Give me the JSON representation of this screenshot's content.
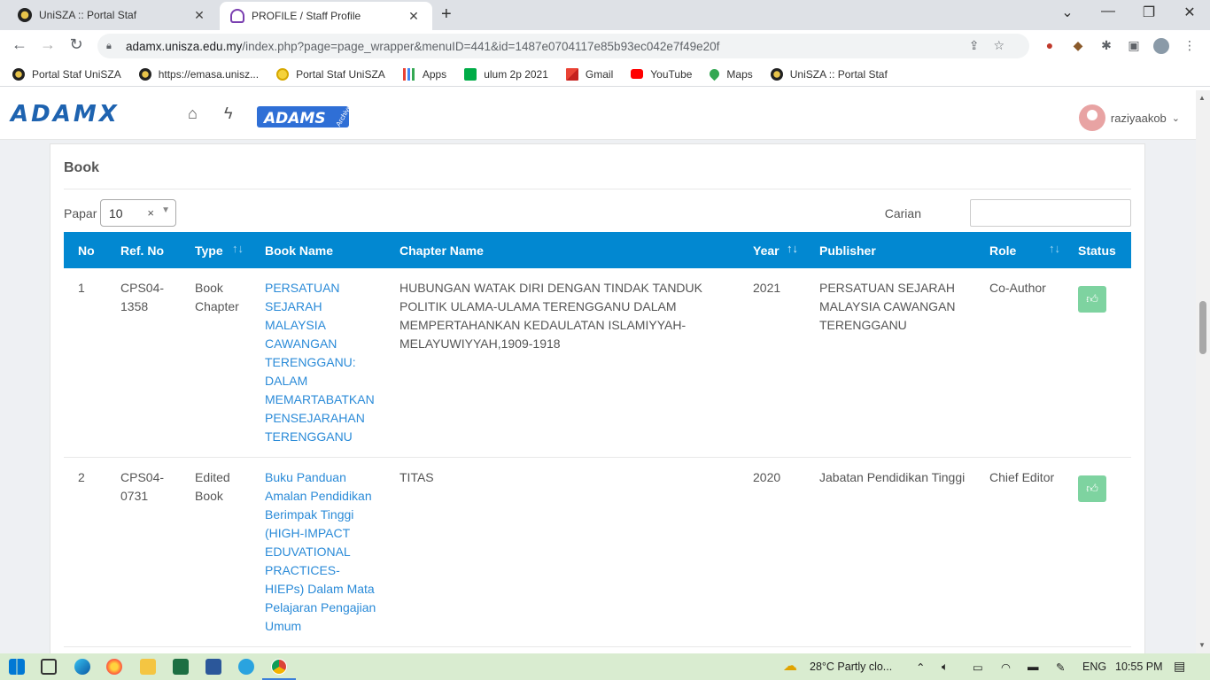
{
  "browser": {
    "tabs": [
      {
        "title": "UniSZA :: Portal Staf",
        "active": false
      },
      {
        "title": "PROFILE / Staff Profile",
        "active": true
      }
    ],
    "url_host": "adamx.unisza.edu.my",
    "url_path": "/index.php?page=page_wrapper&menuID=441&id=1487e0704117e85b93ec042e7f49e20f",
    "bookmarks": [
      {
        "label": "Portal Staf UniSZA",
        "icon": "unisza-icon"
      },
      {
        "label": "https://emasa.unisz...",
        "icon": "unisza-icon"
      },
      {
        "label": "Portal Staf UniSZA",
        "icon": "portal-icon"
      },
      {
        "label": "Apps",
        "icon": "apps-grid-icon"
      },
      {
        "label": "ulum 2p 2021",
        "icon": "meet-icon"
      },
      {
        "label": "Gmail",
        "icon": "gmail-icon"
      },
      {
        "label": "YouTube",
        "icon": "youtube-icon"
      },
      {
        "label": "Maps",
        "icon": "maps-icon"
      },
      {
        "label": "UniSZA :: Portal Staf",
        "icon": "unisza-icon"
      }
    ]
  },
  "header": {
    "logo": "ADAMX",
    "badge": "ADAMS",
    "badge_sub": "Archive",
    "username": "raziyaakob"
  },
  "card": {
    "title": "Book",
    "length_label": "Papar",
    "length_value": "10",
    "search_label": "Carian",
    "columns": [
      "No",
      "Ref. No",
      "Type",
      "Book Name",
      "Chapter Name",
      "Year",
      "Publisher",
      "Role",
      "Status"
    ],
    "rows": [
      {
        "no": "1",
        "ref": "CPS04-1358",
        "type": "Book Chapter",
        "book": "PERSATUAN SEJARAH MALAYSIA CAWANGAN TERENGGANU: DALAM MEMARTABATKAN PENSEJARAHAN TERENGGANU",
        "chapter": "HUBUNGAN WATAK DIRI DENGAN TINDAK TANDUK POLITIK ULAMA-ULAMA TERENGGANU DALAM MEMPERTAHANKAN KEDAULATAN ISLAMIYYAH-MELAYUWIYYAH,1909-1918",
        "year": "2021",
        "publisher": "PERSATUAN SEJARAH MALAYSIA CAWANGAN TERENGGANU",
        "role": "Co-Author"
      },
      {
        "no": "2",
        "ref": "CPS04-0731",
        "type": "Edited Book",
        "book": "Buku Panduan Amalan Pendidikan Berimpak Tinggi (HIGH-IMPACT EDUVATIONAL PRACTICES-HIEPs) Dalam Mata Pelajaran Pengajian Umum",
        "chapter": "TITAS",
        "year": "2020",
        "publisher": "Jabatan Pendidikan Tinggi",
        "role": "Chief Editor"
      }
    ]
  },
  "taskbar": {
    "weather": "28°C  Partly clo...",
    "lang": "ENG",
    "time": "10:55 PM"
  },
  "colors": {
    "table_header": "#0288d1",
    "link": "#2b8bd8",
    "status_button": "#7ed3a0",
    "logo": "#1e63b0"
  }
}
